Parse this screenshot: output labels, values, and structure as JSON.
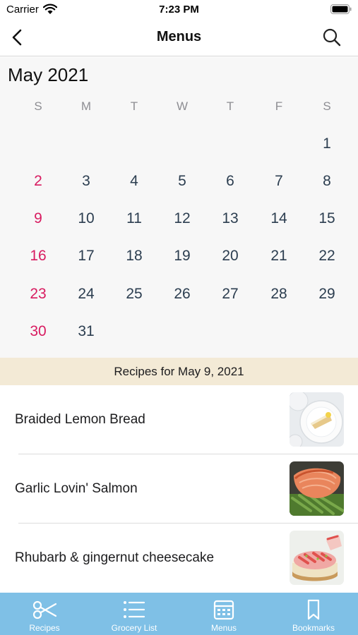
{
  "status_bar": {
    "carrier": "Carrier",
    "time": "7:23 PM"
  },
  "nav": {
    "title": "Menus",
    "back_icon": "chevron-left-icon",
    "search_icon": "search-icon"
  },
  "calendar": {
    "month_title": "May 2021",
    "weekdays": [
      "S",
      "M",
      "T",
      "W",
      "T",
      "F",
      "S"
    ],
    "weeks": [
      [
        "",
        "",
        "",
        "",
        "",
        "",
        "1"
      ],
      [
        "2",
        "3",
        "4",
        "5",
        "6",
        "7",
        "8"
      ],
      [
        "9",
        "10",
        "11",
        "12",
        "13",
        "14",
        "15"
      ],
      [
        "16",
        "17",
        "18",
        "19",
        "20",
        "21",
        "22"
      ],
      [
        "23",
        "24",
        "25",
        "26",
        "27",
        "28",
        "29"
      ],
      [
        "30",
        "31",
        "",
        "",
        "",
        "",
        ""
      ]
    ],
    "sunday_color": "#d81b60",
    "day_color": "#2c3e50"
  },
  "recipes_header": "Recipes for May 9, 2021",
  "recipes": [
    {
      "name": "Braided Lemon Bread"
    },
    {
      "name": "Garlic Lovin' Salmon"
    },
    {
      "name": "Rhubarb & gingernut cheesecake"
    }
  ],
  "tabs": [
    {
      "label": "Recipes",
      "icon": "scissors-icon"
    },
    {
      "label": "Grocery List",
      "icon": "list-icon"
    },
    {
      "label": "Menus",
      "icon": "calendar-icon"
    },
    {
      "label": "Bookmarks",
      "icon": "bookmark-icon"
    }
  ],
  "colors": {
    "tab_bar": "#7fc0e6",
    "header_strip": "#f3ead6",
    "calendar_bg": "#f7f7f7"
  }
}
